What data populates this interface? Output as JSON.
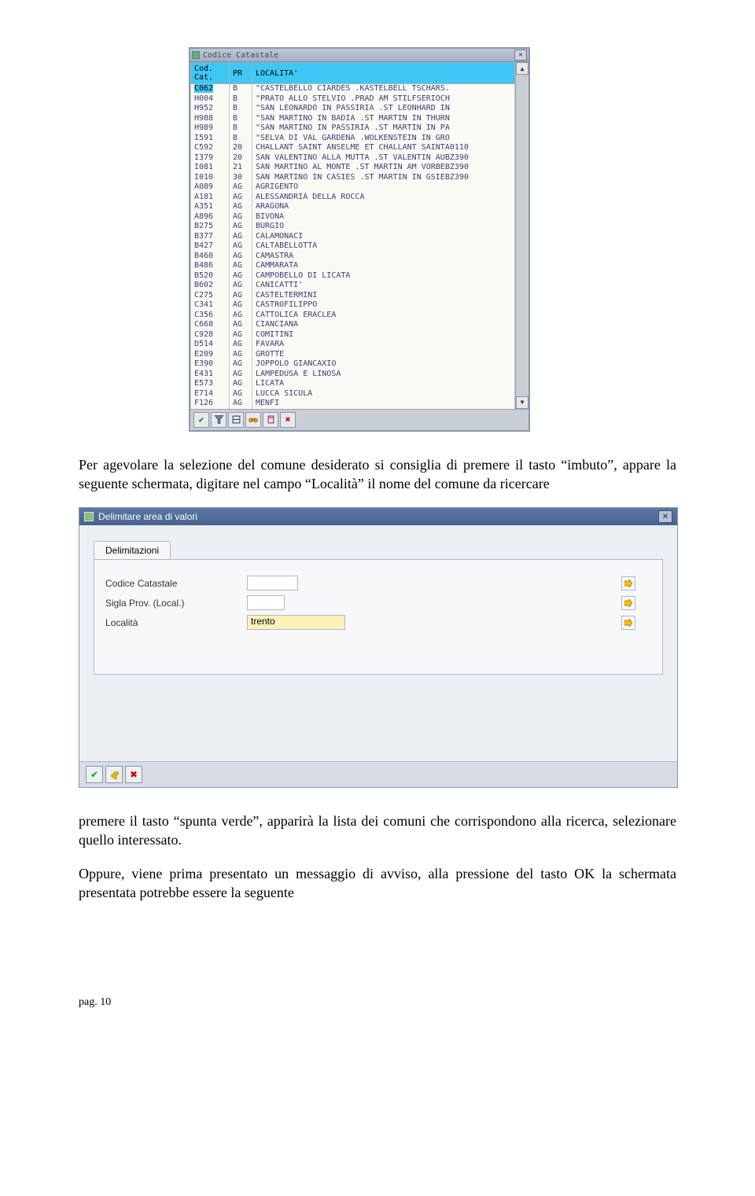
{
  "window1": {
    "title": "Codice Catastale",
    "columns": [
      "Cod. Cat.",
      "PR",
      "LOCALITA'"
    ],
    "rows": [
      {
        "cod": "C062",
        "pr": "B",
        "loc": "\"CASTELBELLO CIARDES .KASTELBELL TSCHARS."
      },
      {
        "cod": "H004",
        "pr": "B",
        "loc": "\"PRATO ALLO STELVIO .PRAD AM STILFSERIOCH"
      },
      {
        "cod": "H952",
        "pr": "B",
        "loc": "\"SAN LEONARDO IN PASSIRIA .ST LEONHARD IN"
      },
      {
        "cod": "H988",
        "pr": "B",
        "loc": "\"SAN MARTINO IN BADIA .ST MARTIN IN THURN"
      },
      {
        "cod": "H989",
        "pr": "B",
        "loc": "\"SAN MARTINO IN PASSIRIA .ST MARTIN IN PA"
      },
      {
        "cod": "I591",
        "pr": "B",
        "loc": "\"SELVA DI VAL GARDENA .WOLKENSTEIN IN GRO"
      },
      {
        "cod": "C592",
        "pr": "20",
        "loc": "CHALLANT SAINT ANSELME ET CHALLANT SAINTA0110"
      },
      {
        "cod": "I379",
        "pr": "20",
        "loc": "SAN VALENTINO ALLA MUTTA .ST VALENTIN AUBZ390"
      },
      {
        "cod": "I081",
        "pr": "21",
        "loc": "SAN MARTINO AL MONTE .ST MARTIN AM VORBEBZ390"
      },
      {
        "cod": "I010",
        "pr": "30",
        "loc": "SAN MARTINO IN CASIES .ST MARTIN IN GSIEBZ390"
      },
      {
        "cod": "A089",
        "pr": "AG",
        "loc": "AGRIGENTO"
      },
      {
        "cod": "A181",
        "pr": "AG",
        "loc": "ALESSANDRIA DELLA ROCCA"
      },
      {
        "cod": "A351",
        "pr": "AG",
        "loc": "ARAGONA"
      },
      {
        "cod": "A896",
        "pr": "AG",
        "loc": "BIVONA"
      },
      {
        "cod": "B275",
        "pr": "AG",
        "loc": "BURGIO"
      },
      {
        "cod": "B377",
        "pr": "AG",
        "loc": "CALAMONACI"
      },
      {
        "cod": "B427",
        "pr": "AG",
        "loc": "CALTABELLOTTA"
      },
      {
        "cod": "B460",
        "pr": "AG",
        "loc": "CAMASTRA"
      },
      {
        "cod": "B486",
        "pr": "AG",
        "loc": "CAMMARATA"
      },
      {
        "cod": "B520",
        "pr": "AG",
        "loc": "CAMPOBELLO DI LICATA"
      },
      {
        "cod": "B602",
        "pr": "AG",
        "loc": "CANICATTI'"
      },
      {
        "cod": "C275",
        "pr": "AG",
        "loc": "CASTELTERMINI"
      },
      {
        "cod": "C341",
        "pr": "AG",
        "loc": "CASTROFILIPPO"
      },
      {
        "cod": "C356",
        "pr": "AG",
        "loc": "CATTOLICA ERACLEA"
      },
      {
        "cod": "C668",
        "pr": "AG",
        "loc": "CIANCIANA"
      },
      {
        "cod": "C928",
        "pr": "AG",
        "loc": "COMITINI"
      },
      {
        "cod": "D514",
        "pr": "AG",
        "loc": "FAVARA"
      },
      {
        "cod": "E209",
        "pr": "AG",
        "loc": "GROTTE"
      },
      {
        "cod": "E390",
        "pr": "AG",
        "loc": "JOPPOLO GIANCAXIO"
      },
      {
        "cod": "E431",
        "pr": "AG",
        "loc": "LAMPEDUSA E LINOSA"
      },
      {
        "cod": "E573",
        "pr": "AG",
        "loc": "LICATA"
      },
      {
        "cod": "E714",
        "pr": "AG",
        "loc": "LUCCA SICULA"
      },
      {
        "cod": "F126",
        "pr": "AG",
        "loc": "MENFI"
      }
    ]
  },
  "para1": "Per agevolare la selezione del comune desiderato si consiglia di premere il tasto “imbuto”, appare la seguente schermata, digitare nel campo “Località” il nome del comune da ricercare",
  "dialog": {
    "title": "Delimitare area di valori",
    "tab": "Delimitazioni",
    "fields": {
      "codice_label": "Codice Catastale",
      "sigla_label": "Sigla Prov. (Local.)",
      "localita_label": "Località",
      "codice_value": "",
      "sigla_value": "",
      "localita_value": "trento"
    }
  },
  "para2": "premere il tasto “spunta verde”, apparirà la lista dei comuni che corrispondono alla ricerca, selezionare quello interessato.",
  "para3": "Oppure, viene prima presentato un messaggio di avviso, alla pressione del tasto OK la schermata presentata potrebbe essere la seguente",
  "footer": "pag. 10"
}
